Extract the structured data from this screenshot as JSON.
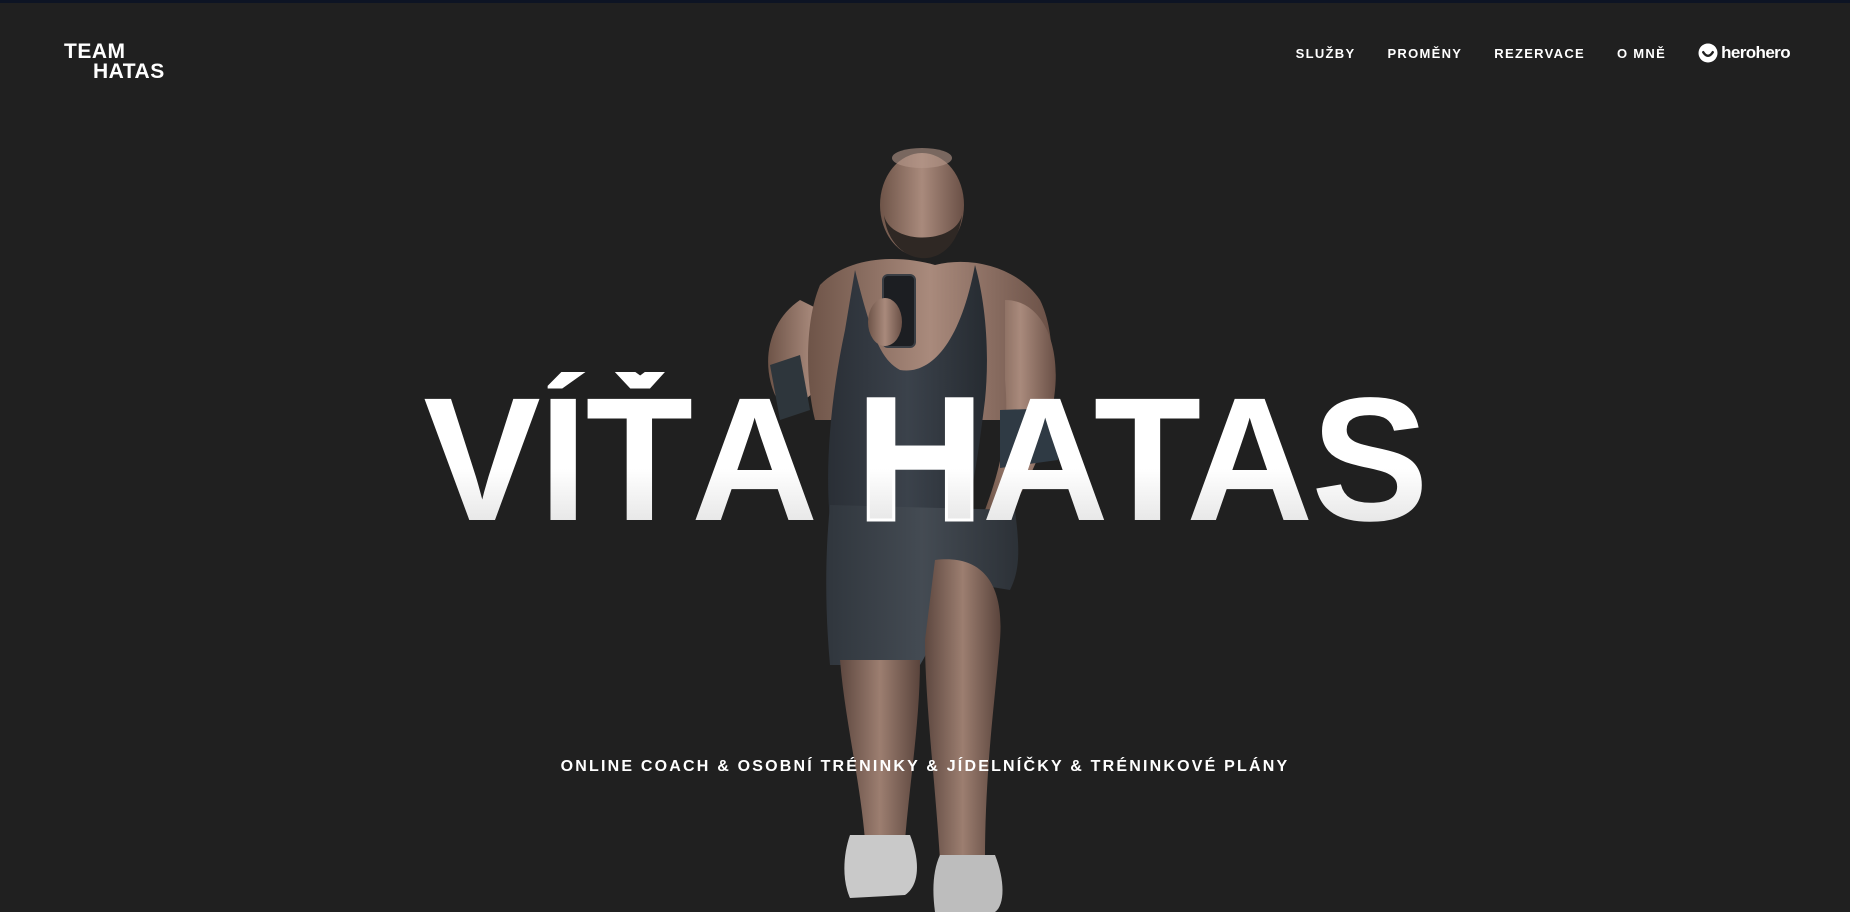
{
  "logo": {
    "line1": "TEAM",
    "line2": "HATAS"
  },
  "nav": {
    "items": [
      {
        "label": "SLUŽBY"
      },
      {
        "label": "PROMĚNY"
      },
      {
        "label": "REZERVACE"
      },
      {
        "label": "O MNĚ"
      }
    ],
    "herohero_label": "herohero",
    "herohero_icon": "herohero-smile-icon"
  },
  "hero": {
    "title_part1": "VÍŤA ",
    "title_outline_letter": "H",
    "title_part2": "ATAS",
    "subtitle": "ONLINE COACH & OSOBNÍ TRÉNINKY & JÍDELNÍČKY & TRÉNINKOVÉ PLÁNY",
    "image": "bodybuilder-mirror-selfie"
  },
  "colors": {
    "background": "#202020",
    "text": "#ffffff"
  }
}
